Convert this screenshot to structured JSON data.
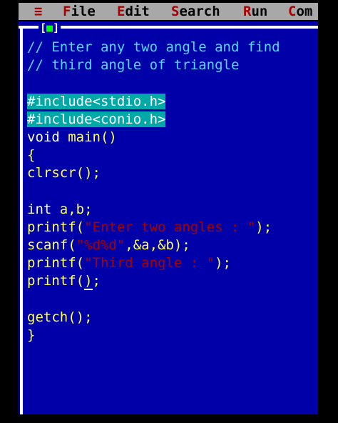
{
  "menu": [
    {
      "hot": "F",
      "rest": "ile"
    },
    {
      "hot": "E",
      "rest": "dit"
    },
    {
      "hot": "S",
      "rest": "earch"
    },
    {
      "hot": "R",
      "rest": "un"
    },
    {
      "hot": "C",
      "rest": "om"
    }
  ],
  "system_menu": "≡",
  "window": {
    "close_left": "[",
    "close_mark": "■",
    "close_right": "]"
  },
  "code_lines": [
    [
      {
        "t": "// Enter any two angle and find",
        "c": "comment"
      }
    ],
    [
      {
        "t": "// third angle of triangle",
        "c": "comment"
      }
    ],
    [],
    [
      {
        "t": "#include<stdio.h>",
        "c": "pre"
      }
    ],
    [
      {
        "t": "#include<conio.h>",
        "c": "pre"
      }
    ],
    [
      {
        "t": "void ",
        "c": "keyword"
      },
      {
        "t": "main()",
        "c": "func"
      }
    ],
    [
      {
        "t": "{",
        "c": "func"
      }
    ],
    [
      {
        "t": "clrscr();",
        "c": "func"
      }
    ],
    [],
    [
      {
        "t": "int ",
        "c": "keyword"
      },
      {
        "t": "a,b;",
        "c": "func"
      }
    ],
    [
      {
        "t": "printf(",
        "c": "func"
      },
      {
        "t": "\"Enter two angles : \"",
        "c": "str"
      },
      {
        "t": ");",
        "c": "func"
      }
    ],
    [
      {
        "t": "scanf(",
        "c": "func"
      },
      {
        "t": "\"%d%d\"",
        "c": "str"
      },
      {
        "t": ",&a,&b);",
        "c": "func"
      }
    ],
    [
      {
        "t": "printf(",
        "c": "func"
      },
      {
        "t": "\"Third angle : \"",
        "c": "str"
      },
      {
        "t": ");",
        "c": "func"
      }
    ],
    [
      {
        "t": "printf(",
        "c": "func"
      },
      {
        "t": ")",
        "c": "func",
        "cursor": true
      },
      {
        "t": ";",
        "c": "func"
      }
    ],
    [],
    [
      {
        "t": "getch();",
        "c": "func"
      }
    ],
    [
      {
        "t": "}",
        "c": "func"
      }
    ]
  ]
}
